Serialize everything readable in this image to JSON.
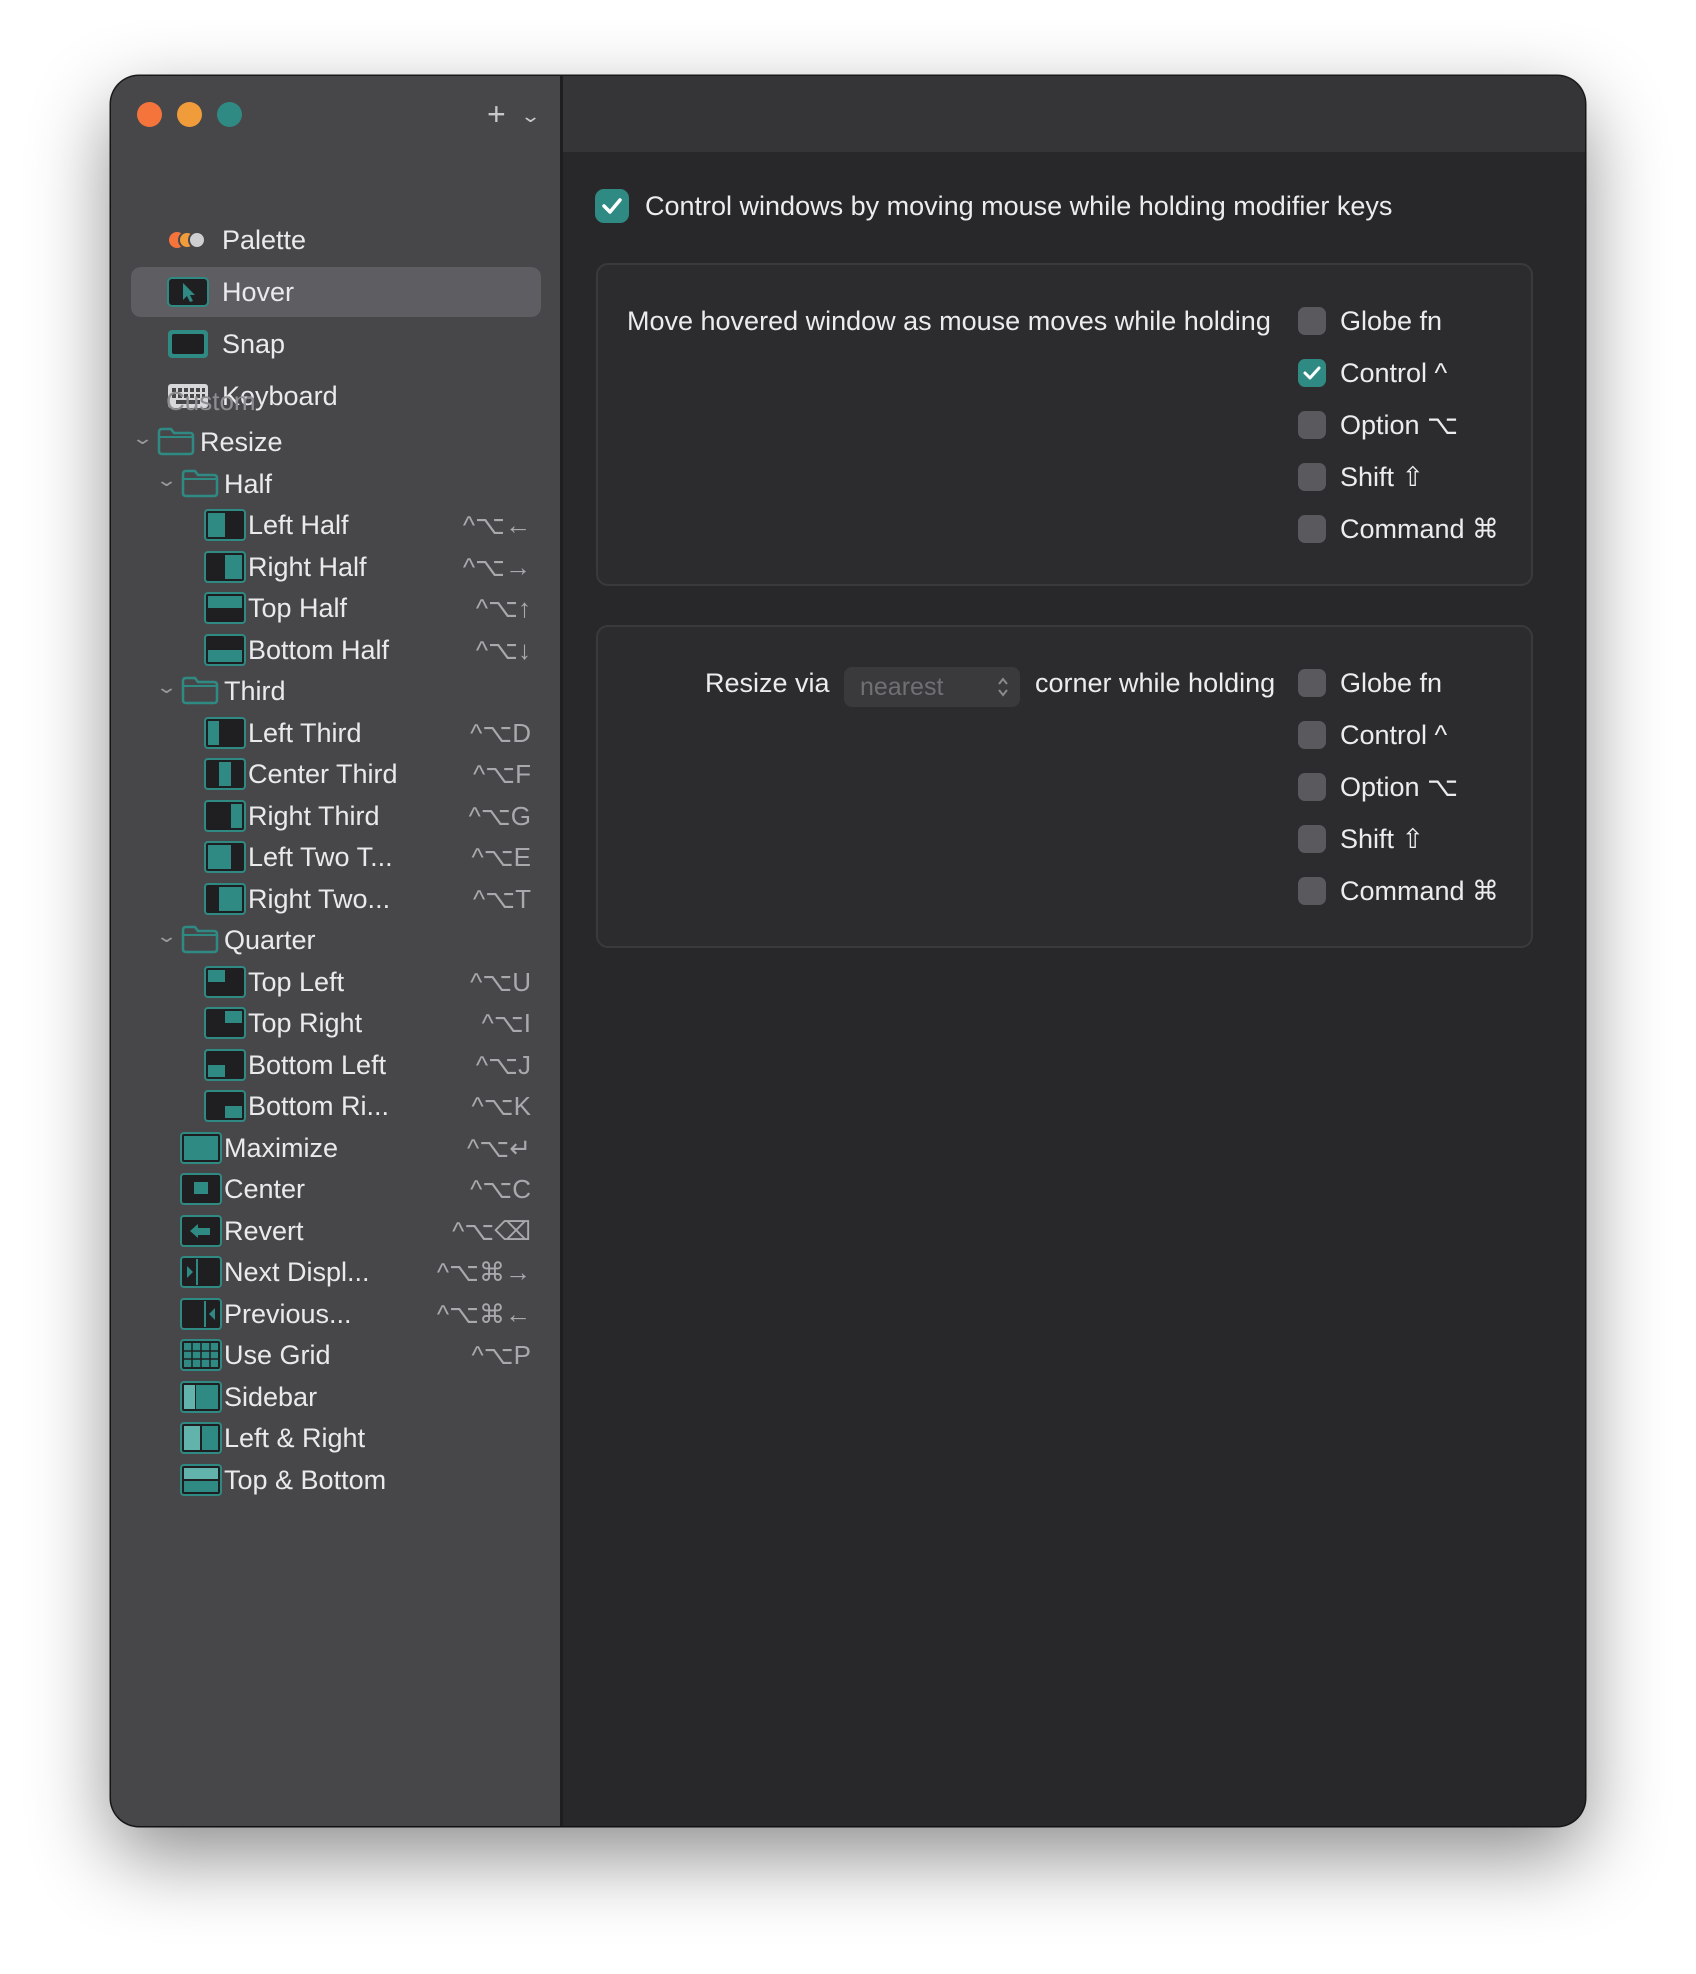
{
  "sidebar": {
    "add_label": "+",
    "nav": [
      {
        "label": "Palette",
        "icon": "palette-icon"
      },
      {
        "label": "Hover",
        "icon": "cursor-icon",
        "selected": true
      },
      {
        "label": "Snap",
        "icon": "snap-icon"
      },
      {
        "label": "Keyboard",
        "icon": "keyboard-icon"
      }
    ],
    "section_header": "Custom",
    "tree": [
      {
        "type": "folder",
        "level": 0,
        "label": "Resize"
      },
      {
        "type": "folder",
        "level": 1,
        "label": "Half"
      },
      {
        "type": "item",
        "level": 2,
        "label": "Left Half",
        "shortcut": "^⌥←",
        "icon": "left-half"
      },
      {
        "type": "item",
        "level": 2,
        "label": "Right Half",
        "shortcut": "^⌥→",
        "icon": "right-half"
      },
      {
        "type": "item",
        "level": 2,
        "label": "Top Half",
        "shortcut": "^⌥↑",
        "icon": "top-half"
      },
      {
        "type": "item",
        "level": 2,
        "label": "Bottom Half",
        "shortcut": "^⌥↓",
        "icon": "bottom-half"
      },
      {
        "type": "folder",
        "level": 1,
        "label": "Third"
      },
      {
        "type": "item",
        "level": 2,
        "label": "Left Third",
        "shortcut": "^⌥D",
        "icon": "left-third"
      },
      {
        "type": "item",
        "level": 2,
        "label": "Center Third",
        "shortcut": "^⌥F",
        "icon": "center-third"
      },
      {
        "type": "item",
        "level": 2,
        "label": "Right Third",
        "shortcut": "^⌥G",
        "icon": "right-third"
      },
      {
        "type": "item",
        "level": 2,
        "label": "Left Two T...",
        "shortcut": "^⌥E",
        "icon": "left-two-thirds"
      },
      {
        "type": "item",
        "level": 2,
        "label": "Right Two...",
        "shortcut": "^⌥T",
        "icon": "right-two-thirds"
      },
      {
        "type": "folder",
        "level": 1,
        "label": "Quarter"
      },
      {
        "type": "item",
        "level": 2,
        "label": "Top Left",
        "shortcut": "^⌥U",
        "icon": "top-left"
      },
      {
        "type": "item",
        "level": 2,
        "label": "Top Right",
        "shortcut": "^⌥I",
        "icon": "top-right"
      },
      {
        "type": "item",
        "level": 2,
        "label": "Bottom Left",
        "shortcut": "^⌥J",
        "icon": "bottom-left"
      },
      {
        "type": "item",
        "level": 2,
        "label": "Bottom Ri...",
        "shortcut": "^⌥K",
        "icon": "bottom-right"
      },
      {
        "type": "item",
        "level": 1,
        "label": "Maximize",
        "shortcut": "^⌥↵",
        "icon": "maximize"
      },
      {
        "type": "item",
        "level": 1,
        "label": "Center",
        "shortcut": "^⌥C",
        "icon": "center"
      },
      {
        "type": "item",
        "level": 1,
        "label": "Revert",
        "shortcut": "^⌥⌫",
        "icon": "revert"
      },
      {
        "type": "item",
        "level": 1,
        "label": "Next Displ...",
        "shortcut": "^⌥⌘→",
        "icon": "next-display"
      },
      {
        "type": "item",
        "level": 1,
        "label": "Previous...",
        "shortcut": "^⌥⌘←",
        "icon": "previous-display"
      },
      {
        "type": "item",
        "level": 1,
        "label": "Use Grid",
        "shortcut": "^⌥P",
        "icon": "grid"
      },
      {
        "type": "item",
        "level": 1,
        "label": "Sidebar",
        "shortcut": "",
        "icon": "sidebar"
      },
      {
        "type": "item",
        "level": 1,
        "label": "Left & Right",
        "shortcut": "",
        "icon": "left-right"
      },
      {
        "type": "item",
        "level": 1,
        "label": "Top & Bottom",
        "shortcut": "",
        "icon": "top-bottom"
      }
    ]
  },
  "toolbar": {
    "help_label": "?"
  },
  "main": {
    "master": {
      "label": "Control windows by moving mouse while holding modifier keys",
      "checked": true
    },
    "move_panel": {
      "label": "Move hovered window as mouse moves while holding",
      "modifiers": [
        {
          "label": "Globe fn",
          "checked": false
        },
        {
          "label": "Control ^",
          "checked": true
        },
        {
          "label": "Option ⌥",
          "checked": false
        },
        {
          "label": "Shift ⇧",
          "checked": false
        },
        {
          "label": "Command ⌘",
          "checked": false
        }
      ]
    },
    "resize_panel": {
      "prefix": "Resize via",
      "select_value": "nearest",
      "suffix": "corner while holding",
      "modifiers": [
        {
          "label": "Globe fn",
          "checked": false
        },
        {
          "label": "Control ^",
          "checked": false
        },
        {
          "label": "Option ⌥",
          "checked": false
        },
        {
          "label": "Shift ⇧",
          "checked": false
        },
        {
          "label": "Command ⌘",
          "checked": false
        }
      ]
    }
  },
  "colors": {
    "accent": "#2f8a83",
    "sidebar_bg": "#47474a",
    "main_bg": "#28282a"
  }
}
